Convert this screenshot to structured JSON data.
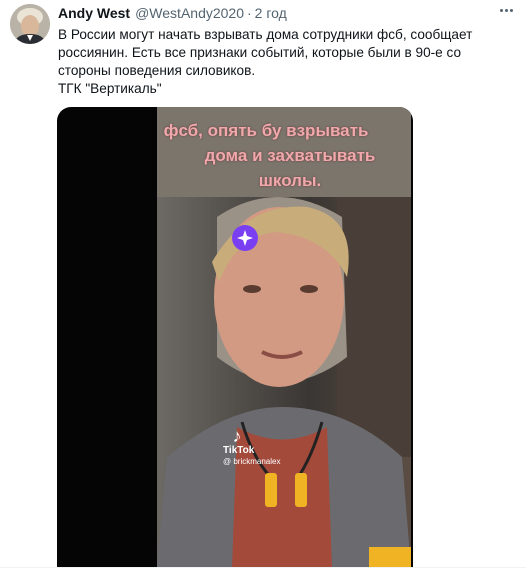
{
  "tweet": {
    "display_name": "Andy West",
    "handle": "@WestAndy2020",
    "separator": "·",
    "time": "2 год",
    "text_lines": [
      "В России могут начать взрывать дома сотрудники фсб, сообщает",
      "россиянин. Есть все признаки событий, которые были в 90-е со",
      "стороны поведения силовиков.",
      "ТГК \"Вертикаль\""
    ]
  },
  "media": {
    "caption_lines": [
      "фсб, опять бу    взрывать",
      "дома и захватывать",
      "школы."
    ],
    "watermark_brand": "TikTok",
    "watermark_user": "@ brickmanalex"
  },
  "icons": {
    "more": "more-horizontal-icon",
    "sparkle": "sparkle-icon",
    "tiktok": "tiktok-logo-icon"
  },
  "colors": {
    "name": "#0f1419",
    "secondary": "#536471",
    "caption": "#f1a8ac",
    "sparkle": "#7b3ff2",
    "media_bg": "#050505"
  }
}
